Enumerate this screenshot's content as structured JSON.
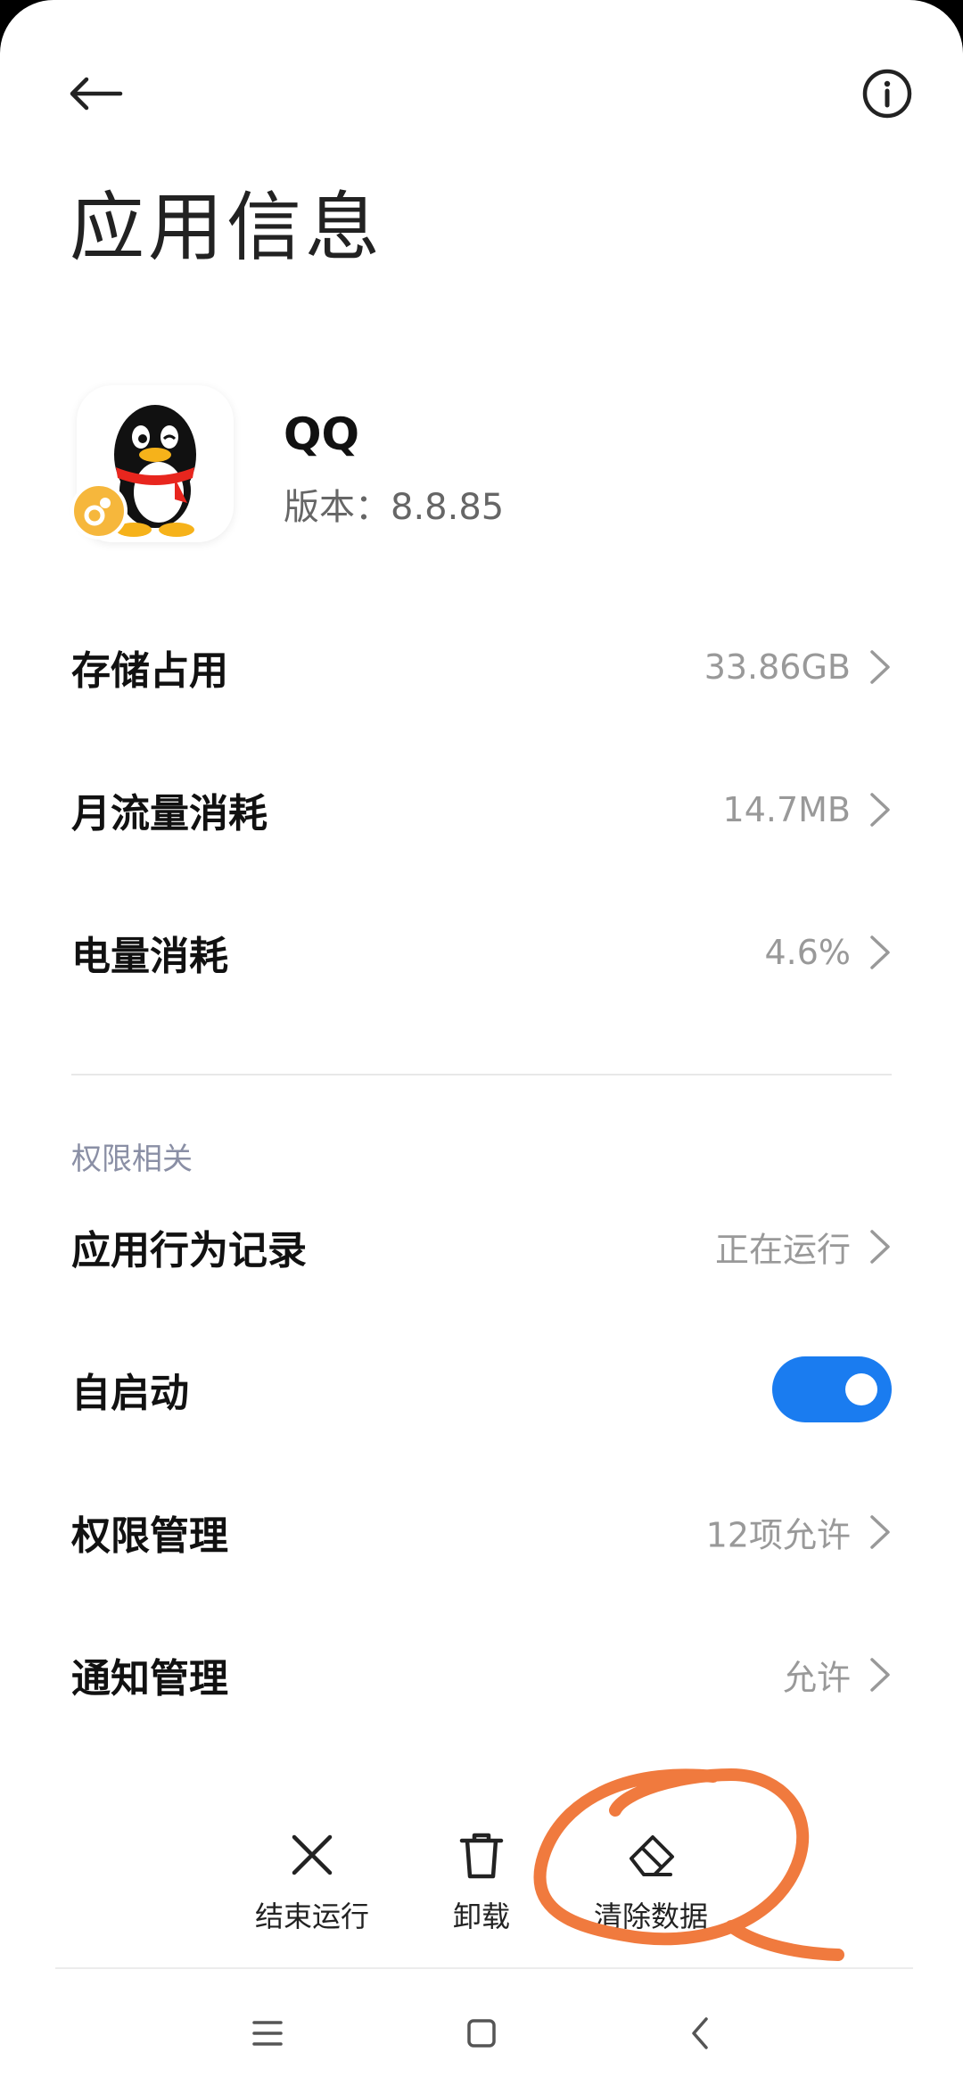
{
  "header": {
    "title": "应用信息"
  },
  "app": {
    "name": "QQ",
    "version": "版本：8.8.85"
  },
  "rows": [
    {
      "label": "存储占用",
      "value": "33.86GB"
    },
    {
      "label": "月流量消耗",
      "value": "14.7MB"
    },
    {
      "label": "电量消耗",
      "value": "4.6%"
    }
  ],
  "permissions_section": {
    "label": "权限相关",
    "items": [
      {
        "label": "应用行为记录",
        "value": "正在运行"
      },
      {
        "label": "自启动",
        "toggle_on": true
      },
      {
        "label": "权限管理",
        "value": "12项允许"
      },
      {
        "label": "通知管理",
        "value": "允许"
      }
    ]
  },
  "actions": [
    {
      "label": "结束运行",
      "icon": "close-icon"
    },
    {
      "label": "卸载",
      "icon": "trash-icon"
    },
    {
      "label": "清除数据",
      "icon": "eraser-icon"
    }
  ],
  "navbar": {
    "icons": [
      "menu-icon",
      "home-square-icon",
      "back-chevron-icon"
    ]
  },
  "colors": {
    "accent": "#1a7cf0",
    "scribble": "#f07a3e",
    "secondary_text": "#999999"
  }
}
